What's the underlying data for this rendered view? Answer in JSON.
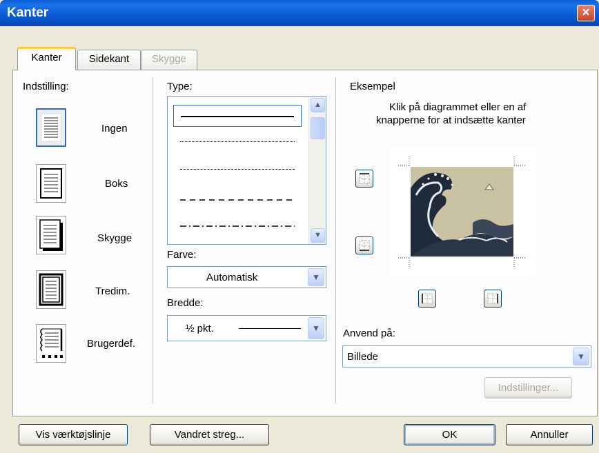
{
  "window": {
    "title": "Kanter",
    "close_icon": "×"
  },
  "tabs": [
    {
      "label": "Kanter"
    },
    {
      "label": "Sidekant"
    },
    {
      "label": "Skygge"
    }
  ],
  "settings": {
    "heading": "Indstilling:",
    "items": [
      "Ingen",
      "Boks",
      "Skygge",
      "Tredim.",
      "Brugerdef."
    ],
    "selected": "Ingen"
  },
  "style": {
    "type_label": "Type:",
    "line_styles": [
      "solid",
      "dotted",
      "dashed",
      "dashed-wide",
      "dash-dot"
    ],
    "selected_style": "solid",
    "color_label": "Farve:",
    "color_value": "Automatisk",
    "width_label": "Bredde:",
    "width_value": "½ pkt."
  },
  "preview": {
    "heading": "Eksempel",
    "instructions_line1": "Klik på diagrammet eller en af",
    "instructions_line2": "knapperne for at indsætte kanter"
  },
  "apply": {
    "label": "Anvend på:",
    "value": "Billede",
    "options_button": "Indstillinger..."
  },
  "footer": {
    "toolbar_button": "Vis værktøjslinje",
    "horizontal_line_button": "Vandret streg...",
    "ok_button": "OK",
    "cancel_button": "Annuller"
  },
  "colors": {
    "titlebar": "#0a5fd8",
    "dialog": "#ece9d8",
    "tab_accent": "#ffc83c",
    "close": "#c8452a"
  }
}
